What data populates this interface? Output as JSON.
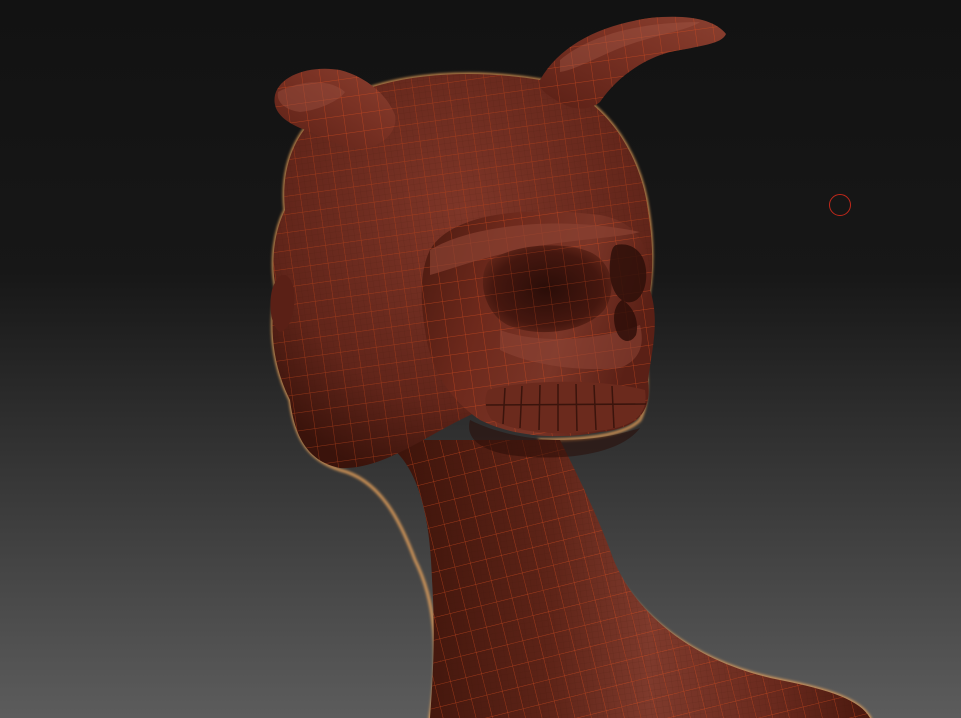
{
  "viewport": {
    "background_top": "#121212",
    "background_bottom": "#5a5a5a",
    "model_name": "demon-head-sculpt"
  },
  "material": {
    "base_color": "#6e2a1e",
    "highlight_color": "#8f4a3a",
    "shadow_color": "#2a0d08",
    "rim_color": "#ffb060",
    "wireframe_color": "#e0501e"
  },
  "brush_cursor": {
    "icon": "brush-circle-icon",
    "color": "#c0281a"
  }
}
